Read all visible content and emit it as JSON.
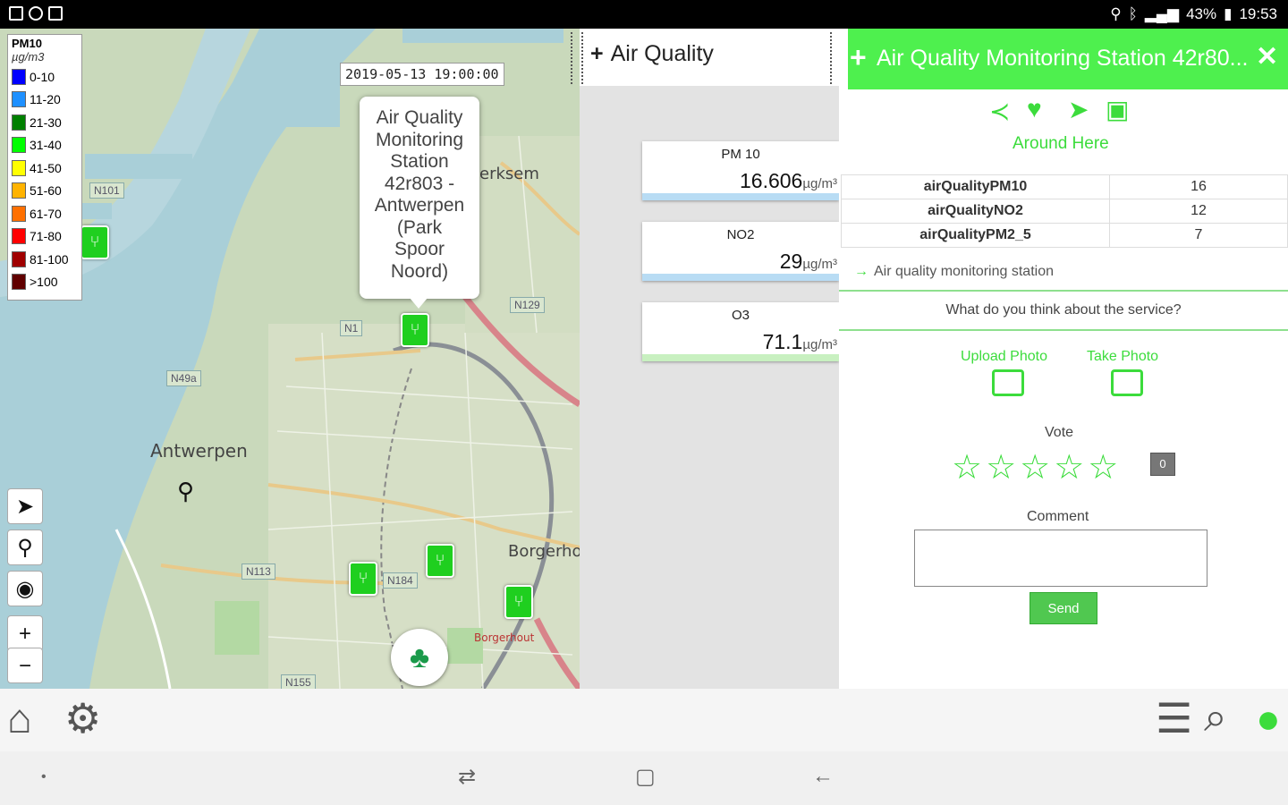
{
  "status_bar": {
    "battery": "43%",
    "time": "19:53"
  },
  "map": {
    "legend": {
      "title": "PM10",
      "unit": "µg/m3",
      "items": [
        {
          "label": "0-10",
          "color": "#0000ff"
        },
        {
          "label": "11-20",
          "color": "#1e90ff"
        },
        {
          "label": "21-30",
          "color": "#008000"
        },
        {
          "label": "31-40",
          "color": "#00ff00"
        },
        {
          "label": "41-50",
          "color": "#ffff00"
        },
        {
          "label": "51-60",
          "color": "#ffb300"
        },
        {
          "label": "61-70",
          "color": "#ff7000"
        },
        {
          "label": "71-80",
          "color": "#ff0000"
        },
        {
          "label": "81-100",
          "color": "#a00000"
        },
        {
          "label": ">100",
          "color": "#600000"
        }
      ]
    },
    "timestamp": "2019-05-13 19:00:00",
    "popup_lines": [
      "Air Quality",
      "Monitoring",
      "Station",
      "42r803 -",
      "Antwerpen",
      "(Park",
      "Spoor",
      "Noord)"
    ],
    "place_labels": {
      "antwerpen": "Antwerpen",
      "merksem": "erksem",
      "borgerhout": "Borgerho",
      "borgerhout_small": "Borgerhout"
    },
    "road_labels": {
      "n101": "N101",
      "n1": "N1",
      "n129": "N129",
      "n49a": "N49a",
      "n113": "N113",
      "n184": "N184",
      "n155": "N155"
    },
    "controls": {
      "zoom_in": "+",
      "zoom_out": "−"
    }
  },
  "middle_panel": {
    "title": "Air Quality",
    "cards": [
      {
        "label": "PM 10",
        "value": "16.606",
        "unit": "µg/m³",
        "bar_color": "#b8dcf4"
      },
      {
        "label": "NO2",
        "value": "29",
        "unit": "µg/m³",
        "bar_color": "#b8dcf4"
      },
      {
        "label": "O3",
        "value": "71.1",
        "unit": "µg/m³",
        "bar_color": "#c8f0c0"
      }
    ]
  },
  "detail_panel": {
    "title": "Air Quality Monitoring Station 42r80...",
    "accent_color": "#4ef04e",
    "around_here": "Around Here",
    "table": [
      {
        "key": "airQualityPM10",
        "value": "16"
      },
      {
        "key": "airQualityNO2",
        "value": "12"
      },
      {
        "key": "airQualityPM2_5",
        "value": "7"
      }
    ],
    "service_link": "Air quality monitoring station",
    "question": "What do you think about the service?",
    "upload_photo": "Upload Photo",
    "take_photo": "Take Photo",
    "vote_label": "Vote",
    "stars": "☆☆☆☆☆",
    "vote_count": "0",
    "comment_label": "Comment",
    "send_label": "Send"
  }
}
